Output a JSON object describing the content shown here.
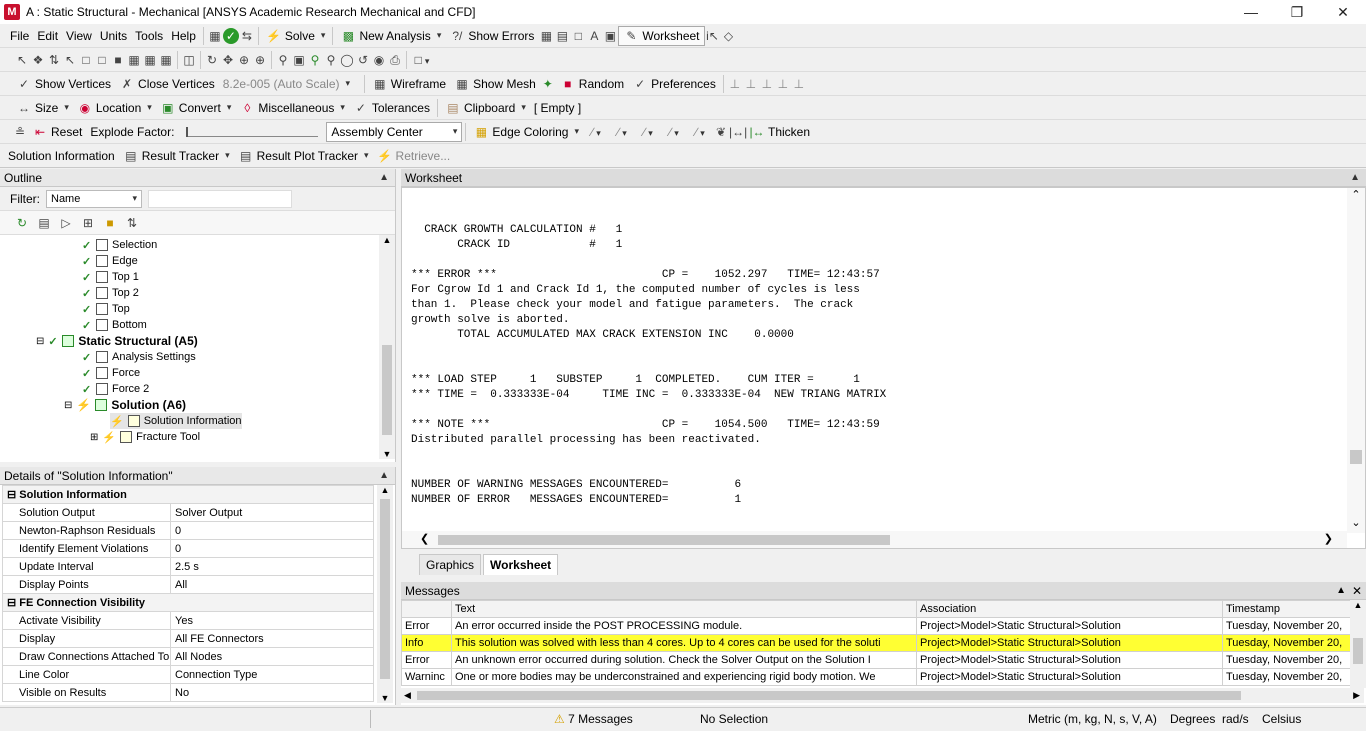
{
  "window": {
    "title": "A : Static Structural - Mechanical [ANSYS Academic Research Mechanical and CFD]",
    "app_icon": "M"
  },
  "menu": [
    "File",
    "Edit",
    "View",
    "Units",
    "Tools",
    "Help"
  ],
  "toolbar1": {
    "solve": "Solve",
    "new_analysis": "New Analysis",
    "show_errors": "Show Errors",
    "worksheet": "Worksheet"
  },
  "toolbar3": {
    "show_vertices": "Show Vertices",
    "close_vertices": "Close Vertices",
    "scale": "8.2e-005 (Auto Scale)",
    "wireframe": "Wireframe",
    "show_mesh": "Show Mesh",
    "random": "Random",
    "preferences": "Preferences"
  },
  "toolbar4": {
    "size": "Size",
    "location": "Location",
    "convert": "Convert",
    "misc": "Miscellaneous",
    "tolerances": "Tolerances",
    "clipboard": "Clipboard",
    "empty": "[ Empty ]"
  },
  "toolbar5": {
    "reset": "Reset",
    "explode": "Explode Factor:",
    "center": "Assembly Center",
    "edge_coloring": "Edge Coloring",
    "thicken": "Thicken"
  },
  "toolbar6": {
    "solution_info": "Solution Information",
    "result_tracker": "Result Tracker",
    "result_plot_tracker": "Result Plot Tracker",
    "retrieve": "Retrieve..."
  },
  "outline": {
    "title": "Outline",
    "filter_label": "Filter:",
    "filter_value": "Name",
    "items": [
      {
        "label": "Selection",
        "bold": false
      },
      {
        "label": "Edge",
        "bold": false
      },
      {
        "label": "Top 1",
        "bold": false
      },
      {
        "label": "Top 2",
        "bold": false
      },
      {
        "label": "Top",
        "bold": false
      },
      {
        "label": "Bottom",
        "bold": false
      },
      {
        "label": "Static Structural (A5)",
        "bold": true
      },
      {
        "label": "Analysis Settings",
        "bold": false
      },
      {
        "label": "Force",
        "bold": false
      },
      {
        "label": "Force 2",
        "bold": false
      },
      {
        "label": "Solution (A6)",
        "bold": true
      },
      {
        "label": "Solution Information",
        "bold": false
      },
      {
        "label": "Fracture Tool",
        "bold": false
      }
    ]
  },
  "details": {
    "title": "Details of \"Solution Information\"",
    "rows": [
      {
        "k": "Solution Information",
        "v": "",
        "cat": true
      },
      {
        "k": "Solution Output",
        "v": "Solver Output"
      },
      {
        "k": "Newton-Raphson Residuals",
        "v": "0"
      },
      {
        "k": "Identify Element Violations",
        "v": "0"
      },
      {
        "k": "Update Interval",
        "v": "2.5 s"
      },
      {
        "k": "Display Points",
        "v": "All"
      },
      {
        "k": "FE Connection Visibility",
        "v": "",
        "cat": true
      },
      {
        "k": "Activate Visibility",
        "v": "Yes"
      },
      {
        "k": "Display",
        "v": "All FE Connectors"
      },
      {
        "k": "Draw Connections Attached To",
        "v": "All Nodes"
      },
      {
        "k": "Line Color",
        "v": "Connection Type"
      },
      {
        "k": "Visible on Results",
        "v": "No"
      }
    ]
  },
  "worksheet": {
    "title": "Worksheet",
    "text": "  CRACK GROWTH CALCULATION #   1\n       CRACK ID            #   1\n\n*** ERROR ***                         CP =    1052.297   TIME= 12:43:57\nFor Cgrow Id 1 and Crack Id 1, the computed number of cycles is less\nthan 1.  Please check your model and fatigue parameters.  The crack\ngrowth solve is aborted.\n       TOTAL ACCUMULATED MAX CRACK EXTENSION INC    0.0000\n\n\n*** LOAD STEP     1   SUBSTEP     1  COMPLETED.    CUM ITER =      1\n*** TIME =  0.333333E-04     TIME INC =  0.333333E-04  NEW TRIANG MATRIX\n\n*** NOTE ***                          CP =    1054.500   TIME= 12:43:59\nDistributed parallel processing has been reactivated.\n\n\nNUMBER OF WARNING MESSAGES ENCOUNTERED=          6\nNUMBER OF ERROR   MESSAGES ENCOUNTERED=          1",
    "tabs": [
      "Graphics",
      "Worksheet"
    ]
  },
  "messages": {
    "title": "Messages",
    "headers": [
      "",
      "Text",
      "Association",
      "Timestamp"
    ],
    "rows": [
      {
        "type": "Error",
        "text": "An error occurred inside the POST PROCESSING module.",
        "assoc": "Project>Model>Static Structural>Solution",
        "time": "Tuesday, November 20,"
      },
      {
        "type": "Info",
        "text": "This solution was solved with less than 4 cores.  Up to 4 cores can be used for the soluti",
        "assoc": "Project>Model>Static Structural>Solution",
        "time": "Tuesday, November 20,"
      },
      {
        "type": "Error",
        "text": "An unknown error occurred during solution.  Check the Solver Output on the Solution I",
        "assoc": "Project>Model>Static Structural>Solution",
        "time": "Tuesday, November 20,"
      },
      {
        "type": "Warninc",
        "text": "One or more bodies may be underconstrained and experiencing rigid body motion.  We",
        "assoc": "Project>Model>Static Structural>Solution",
        "time": "Tuesday, November 20,"
      }
    ]
  },
  "status": {
    "messages": "7 Messages",
    "selection": "No Selection",
    "units": "Metric (m, kg, N, s, V, A)",
    "angle": "Degrees",
    "rate": "rad/s",
    "temp": "Celsius"
  },
  "colors": {
    "highlight": "#ffff33",
    "check": "#2a8a2a",
    "error_icon": "#cc2222"
  }
}
